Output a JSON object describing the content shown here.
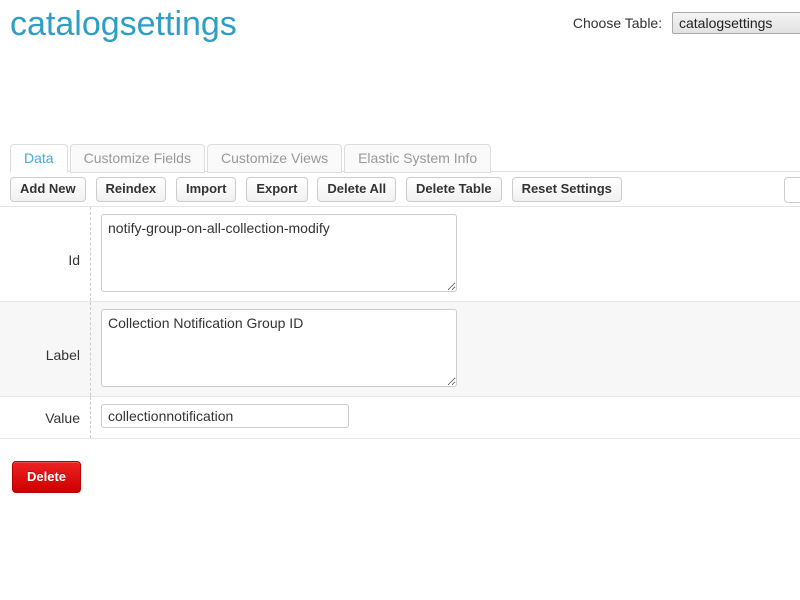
{
  "header": {
    "title": "catalogsettings",
    "choose_table_label": "Choose Table:",
    "selected_table": "catalogsettings",
    "title_color": "#2e9fc4"
  },
  "tabs": [
    {
      "label": "Data",
      "active": true
    },
    {
      "label": "Customize Fields",
      "active": false
    },
    {
      "label": "Customize Views",
      "active": false
    },
    {
      "label": "Elastic System Info",
      "active": false
    }
  ],
  "toolbar": {
    "buttons": [
      {
        "label": "Add New"
      },
      {
        "label": "Reindex"
      },
      {
        "label": "Import"
      },
      {
        "label": "Export"
      },
      {
        "label": "Delete All"
      },
      {
        "label": "Delete Table"
      },
      {
        "label": "Reset Settings"
      }
    ],
    "search": {
      "value": "",
      "placeholder": ""
    }
  },
  "record": {
    "fields": [
      {
        "label": "Id",
        "value": "notify-group-on-all-collection-modify",
        "type": "textarea",
        "striped": false
      },
      {
        "label": "Label",
        "value": "Collection Notification Group ID",
        "type": "textarea",
        "striped": true
      },
      {
        "label": "Value",
        "value": "collectionnotification",
        "type": "input",
        "striped": false
      }
    ],
    "delete_label": "Delete",
    "delete_color": "#dd1111"
  }
}
